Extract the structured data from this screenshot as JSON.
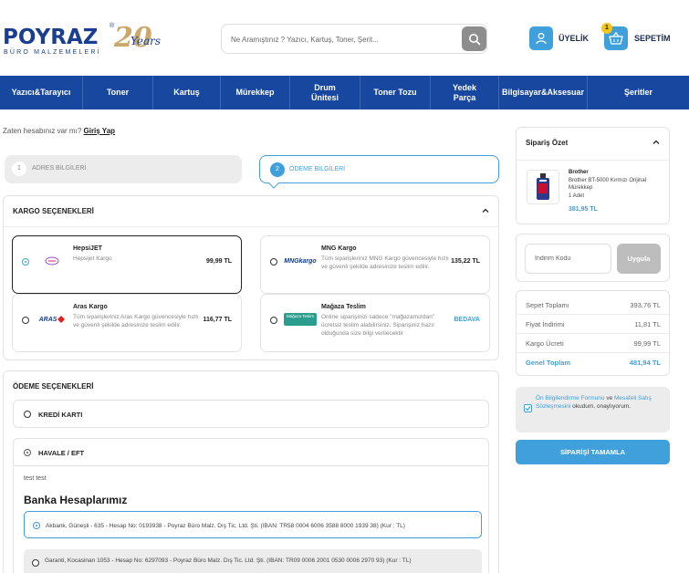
{
  "header": {
    "logo_text": "POYRAZ",
    "logo_sub": "BÜRO MALZEMELERİ",
    "logo_20": "20",
    "logo_years": "Years",
    "logo_reg": "®",
    "search_placeholder": "Ne Aramıştınız ? Yazıcı, Kartuş, Toner, Şerit...",
    "user_label": "ÜYELİK",
    "cart_label": "SEPETİM",
    "cart_count": "1"
  },
  "nav": [
    {
      "label": "Yazıcı&Tarayıcı"
    },
    {
      "label": "Toner"
    },
    {
      "label": "Kartuş"
    },
    {
      "label": "Mürekkep"
    },
    {
      "label": "Drum Ünitesi"
    },
    {
      "label": "Toner Tozu"
    },
    {
      "label": "Yedek Parça"
    },
    {
      "label": "Bilgisayar&Aksesuar"
    },
    {
      "label": "Şeritler"
    }
  ],
  "login": {
    "text": "Zaten hesabınız var mı?",
    "link": "Giriş Yap"
  },
  "steps": [
    {
      "num": "1",
      "label": "ADRES BİLGİLERİ"
    },
    {
      "num": "2",
      "label": "ÖDEME BİLGİLERİ"
    }
  ],
  "kargo": {
    "title": "KARGO SEÇENEKLERİ",
    "options": [
      {
        "name": "HepsiJET",
        "desc": "Hepsijet Kargo",
        "price": "99,99 TL",
        "logo": "hepsijet-logo"
      },
      {
        "name": "MNG Kargo",
        "desc": "Tüm siparişleriniz MNG Kargo güvencesiyle hızlı ve güvenli şekilde adresinize teslim edilir.",
        "price": "135,22 TL",
        "logo": "mng-logo",
        "logo_text": "MNGkargo"
      },
      {
        "name": "Aras Kargo",
        "desc": "Tüm siparişleriniz Aras Kargo güvencesiyle hızlı ve güvenli şekilde adresinize teslim edilir.",
        "price": "116,77 TL",
        "logo": "aras-logo",
        "logo_text": "ARAS"
      },
      {
        "name": "Mağaza Teslim",
        "desc": "Online siparişinizi sadece \"mağazamızdan\" ücretsiz teslim alabilirsiniz. Siparişiniz hazır olduğunda size bilgi verilecektir",
        "price": "BEDAVA",
        "logo": "store-pickup-logo",
        "logo_text": "Mağaza Teslim"
      }
    ]
  },
  "odeme": {
    "title": "ÖDEME SEÇENEKLERİ",
    "options": [
      {
        "label": "KREDİ KARTI"
      },
      {
        "label": "HAVALE / EFT"
      }
    ],
    "havale_note": "test test",
    "banks_title": "Banka Hesaplarımız",
    "banks": [
      {
        "text": "Akbank, Güneşli - 635 - Hesap No: 0193938 - Poyraz Büro Malz. Dış Tic. Ltd. Şti. (IBAN: TR58 0004 6006 3588 8000 1939 38) (Kur : TL)"
      },
      {
        "text": "Garanti, Kocasinan 1053 - Hesap No: 6297093 - Poyraz Büro Malz. Dış Tic. Ltd. Şti. (IBAN: TR09 0006 2001 0530 0006 2970 93) (Kur : TL)"
      }
    ]
  },
  "summary": {
    "title": "Sipariş Özet",
    "product": {
      "brand": "Brother",
      "name": "Brother BT-5000 Kırmızı Orijinal Mürekkep",
      "qty": "1 Adet",
      "price": "381,95 TL"
    }
  },
  "coupon": {
    "placeholder": "İndirim Kodu",
    "button": "Uygula"
  },
  "totals": [
    {
      "label": "Sepet Toplamı",
      "value": "393,76 TL"
    },
    {
      "label": "Fiyat İndirimi",
      "value": "11,81 TL"
    },
    {
      "label": "Kargo Ücreti",
      "value": "99,99 TL"
    },
    {
      "label": "Genel Toplam",
      "value": "481,94 TL"
    }
  ],
  "agreement": {
    "link1": "Ön Bilgilendirme Formunu",
    "mid": " ve ",
    "link2": "Mesafeli Satış Sözleşmesini",
    "end": " okudum, onaylıyorum."
  },
  "order_button": "SİPARİŞİ TAMAMLA",
  "colors": {
    "nav": "#17479e",
    "accent": "#3fa0dc",
    "badge": "#f5c518"
  }
}
